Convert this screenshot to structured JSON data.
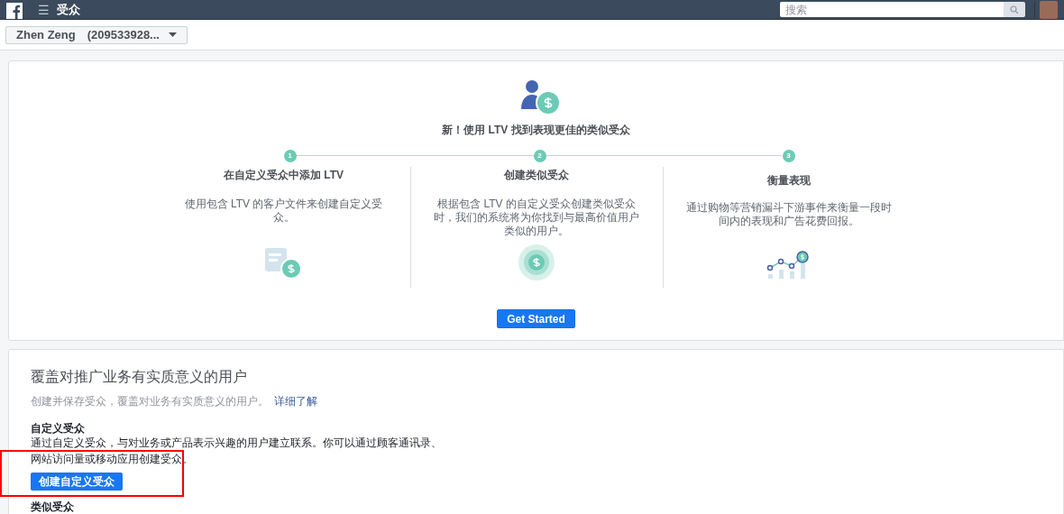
{
  "top_bar": {
    "menu_glyph": "☰",
    "title": "受众",
    "search": {
      "placeholder": "搜索"
    }
  },
  "account_selector": {
    "label": "Zhen Zeng　(209533928..."
  },
  "ltv_promo": {
    "headline": "新！使用 LTV 找到表现更佳的类似受众",
    "steps": [
      {
        "number": "1",
        "title": "在自定义受众中添加 LTV",
        "description": "使用包含 LTV 的客户文件来创建自定义受众。",
        "kind": "document"
      },
      {
        "number": "2",
        "title": "创建类似受众",
        "description": "根据包含 LTV 的自定义受众创建类似受众时，我们的系统将为你找到与最高价值用户类似的用户。",
        "kind": "coin"
      },
      {
        "number": "3",
        "title": "衡量表现",
        "description": "通过购物等营销漏斗下游事件来衡量一段时间内的表现和广告花费回报。",
        "kind": "chart"
      }
    ],
    "button": "Get Started"
  },
  "audiences": {
    "title": "覆盖对推广业务有实质意义的用户",
    "subtitle": "创建并保存受众，覆盖对业务有实质意义的用户。",
    "link": "详细了解",
    "sections": [
      {
        "title": "自定义受众",
        "description": "通过自定义受众，与对业务或产品表示兴趣的用户建立联系。你可以通过顾客通讯录、网站访问量或移动应用创建受众。",
        "button": "创建自定义受众",
        "highlighted": true
      },
      {
        "title": "类似受众"
      }
    ]
  }
}
